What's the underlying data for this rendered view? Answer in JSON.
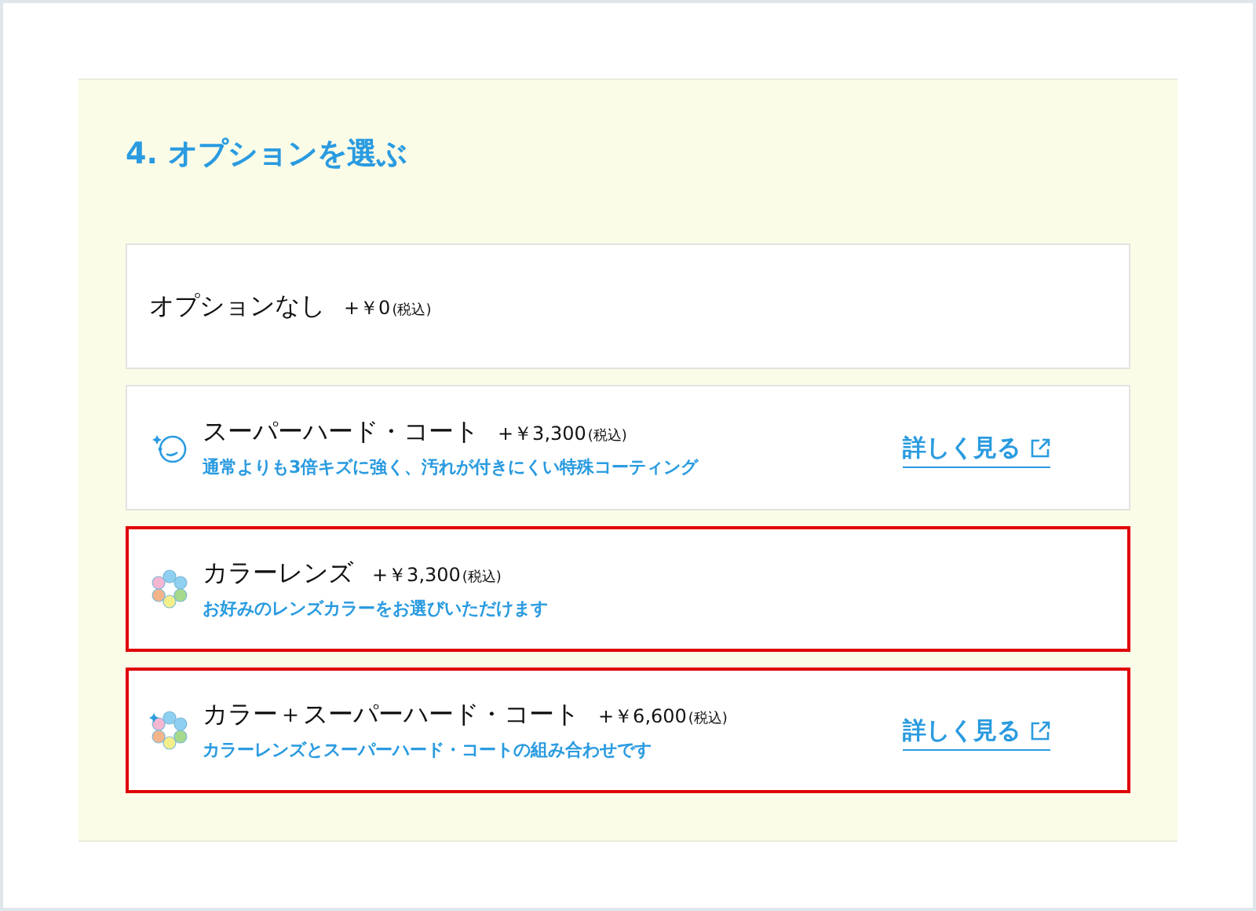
{
  "title": "4. オプションを選ぶ",
  "options": [
    {
      "kind": "none",
      "name": "オプションなし",
      "price": "+￥0",
      "tax": "(税込)",
      "highlighted": false
    },
    {
      "kind": "coat",
      "name": "スーパーハード・コート",
      "price": "+￥3,300",
      "tax": "(税込)",
      "description": "通常よりも3倍キズに強く、汚れが付きにくい特殊コーティング",
      "link": "詳しく見る",
      "highlighted": false
    },
    {
      "kind": "color",
      "name": "カラーレンズ",
      "price": "+￥3,300",
      "tax": "(税込)",
      "description": "お好みのレンズカラーをお選びいただけます",
      "highlighted": true
    },
    {
      "kind": "combo",
      "name": "カラー＋スーパーハード・コート",
      "price": "+￥6,600",
      "tax": "(税込)",
      "description": "カラーレンズとスーパーハード・コートの組み合わせです",
      "link": "詳しく見る",
      "highlighted": true
    }
  ]
}
